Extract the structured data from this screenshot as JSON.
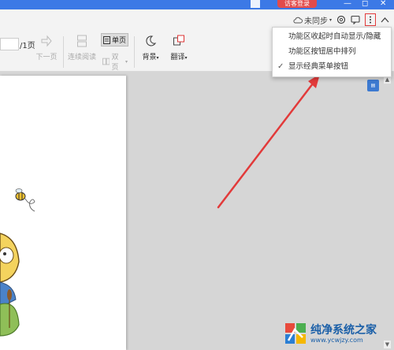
{
  "titlebar": {
    "guest_login": "访客登录"
  },
  "header": {
    "sync_label": "未同步"
  },
  "toolbar": {
    "page_total": "/1页",
    "next_page": "下一页",
    "continuous_read": "连续阅读",
    "single_page": "单页",
    "double_page": "双页",
    "background": "背景",
    "translate": "翻译"
  },
  "dropdown": {
    "items": [
      {
        "label": "功能区收起时自动显示/隐藏",
        "checked": false
      },
      {
        "label": "功能区按钮居中排列",
        "checked": false
      },
      {
        "label": "显示经典菜单按钮",
        "checked": true
      }
    ]
  },
  "watermark": {
    "title": "纯净系统之家",
    "url": "www.ycwjzy.com"
  },
  "colors": {
    "accent": "#3c79e6",
    "arrow": "#e23a3a",
    "guest": "#e24b4b"
  }
}
